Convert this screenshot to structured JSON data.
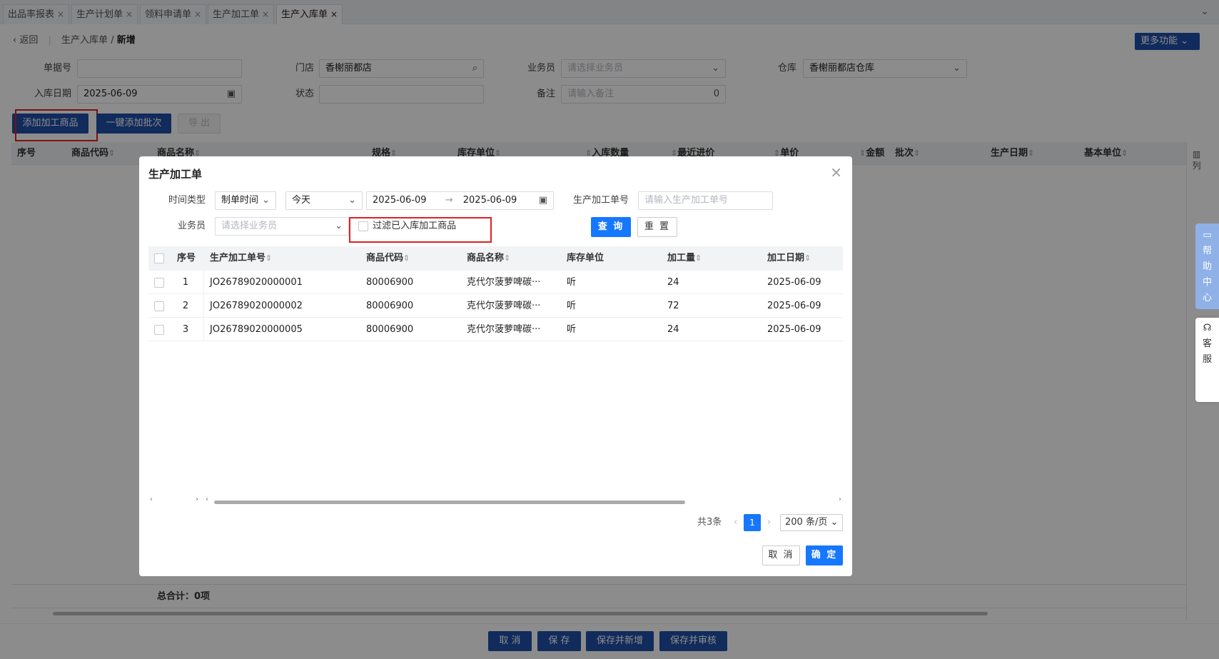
{
  "tabs": [
    {
      "label": "出品率报表"
    },
    {
      "label": "生产计划单"
    },
    {
      "label": "领料申请单"
    },
    {
      "label": "生产加工单"
    },
    {
      "label": "生产入库单"
    }
  ],
  "tab_close": "×",
  "breadcrumb": {
    "back": "返回",
    "parent": "生产入库单",
    "sep": "/",
    "current": "新增"
  },
  "more_button": "更多功能",
  "form": {
    "doc_no_label": "单据号",
    "doc_no_value": "",
    "store_label": "门店",
    "store_value": "香榭丽都店",
    "salesman_label": "业务员",
    "salesman_placeholder": "请选择业务员",
    "warehouse_label": "仓库",
    "warehouse_value": "香榭丽都店仓库",
    "date_label": "入库日期",
    "date_value": "2025-06-09",
    "status_label": "状态",
    "status_value": "",
    "remark_label": "备注",
    "remark_placeholder": "请输入备注",
    "remark_count": "0"
  },
  "toolbar": {
    "add_product": "添加加工商品",
    "add_batch": "一键添加批次",
    "export": "导 出"
  },
  "main_table": {
    "headers": [
      "序号",
      "商品代码",
      "商品名称",
      "规格",
      "库存单位",
      "入库数量",
      "最近进价",
      "单价",
      "金额",
      "批次",
      "生产日期",
      "基本单位"
    ],
    "column_toggle": "列"
  },
  "total_label": "总合计：0项",
  "bottom_buttons": {
    "cancel": "取 消",
    "save": "保 存",
    "save_new": "保存并新增",
    "save_review": "保存并审核"
  },
  "side": {
    "help": [
      "帮",
      "助",
      "中",
      "心"
    ],
    "service": [
      "客",
      "服"
    ]
  },
  "modal": {
    "title": "生产加工单",
    "close": "×",
    "time_type_label": "时间类型",
    "time_type_value": "制单时间",
    "period_value": "今天",
    "date_start": "2025-06-09",
    "date_arrow": "→",
    "date_end": "2025-06-09",
    "order_no_label": "生产加工单号",
    "order_no_placeholder": "请输入生产加工单号",
    "salesman_label": "业务员",
    "salesman_placeholder": "请选择业务员",
    "filter_label": "过滤已入库加工商品",
    "query_button": "查 询",
    "reset_button": "重 置",
    "headers": [
      "序号",
      "生产加工单号",
      "商品代码",
      "商品名称",
      "库存单位",
      "加工量",
      "加工日期"
    ],
    "rows": [
      {
        "index": "1",
        "order_no": "JO26789020000001",
        "code": "80006900",
        "name": "克代尔菠萝啤碳···",
        "unit": "听",
        "qty": "24",
        "date": "2025-06-09"
      },
      {
        "index": "2",
        "order_no": "JO26789020000002",
        "code": "80006900",
        "name": "克代尔菠萝啤碳···",
        "unit": "听",
        "qty": "72",
        "date": "2025-06-09"
      },
      {
        "index": "3",
        "order_no": "JO26789020000005",
        "code": "80006900",
        "name": "克代尔菠萝啤碳···",
        "unit": "听",
        "qty": "24",
        "date": "2025-06-09"
      }
    ],
    "total": "共3条",
    "page": "1",
    "page_size": "200 条/页",
    "cancel_button": "取 消",
    "confirm_button": "确 定"
  }
}
